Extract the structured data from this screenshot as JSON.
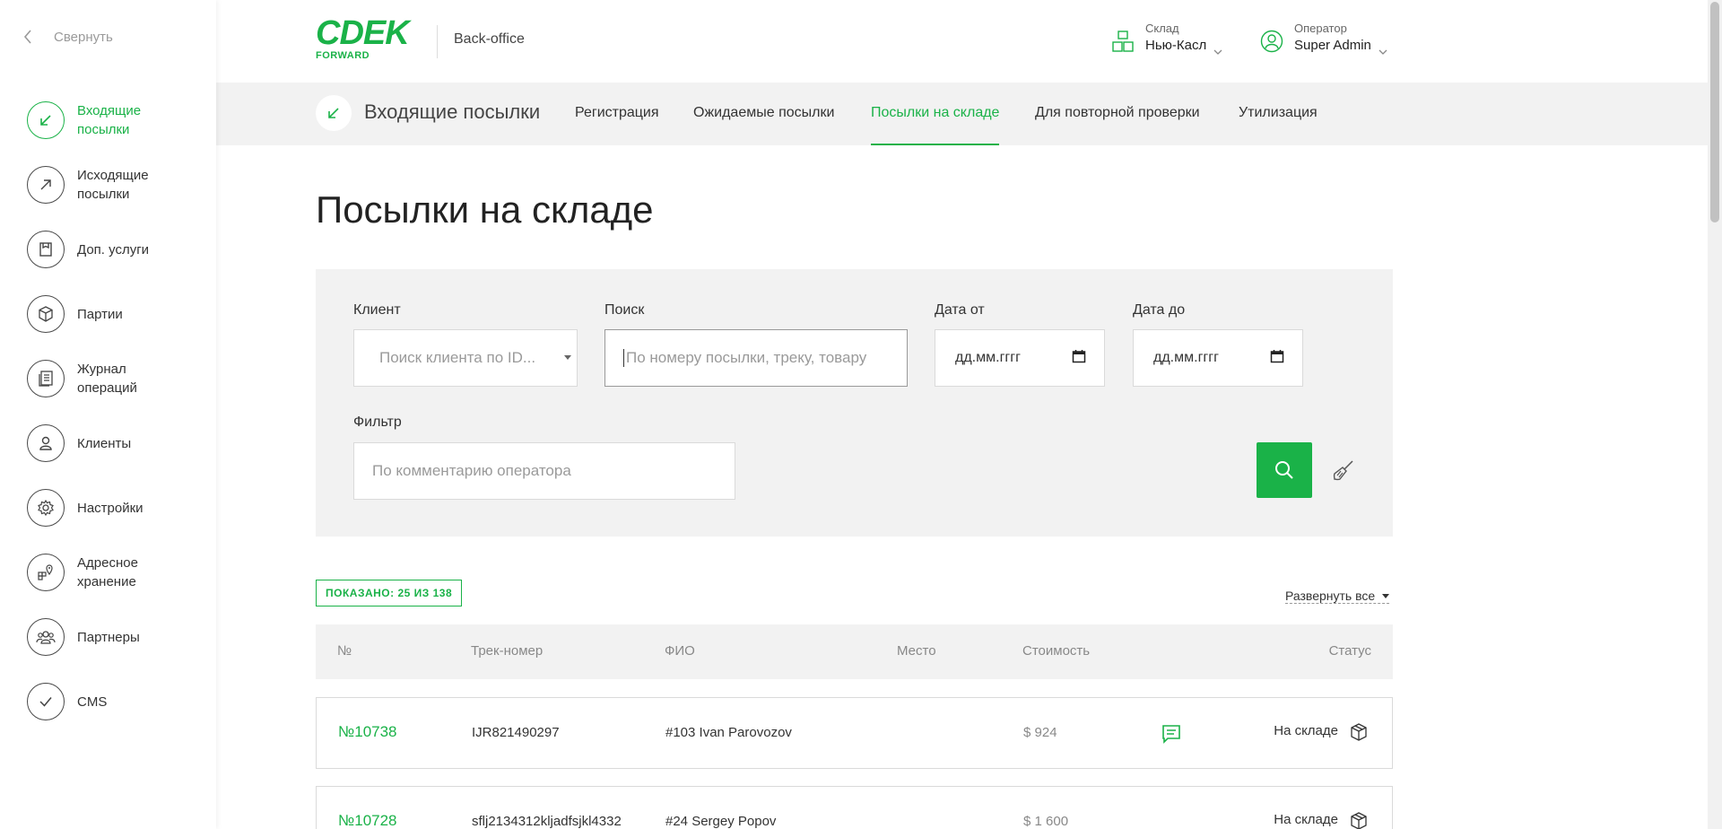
{
  "sidebar": {
    "collapse_label": "Свернуть",
    "items": [
      {
        "label_line1": "Входящие",
        "label_line2": "посылки",
        "icon": "arrow-in-icon",
        "active": true
      },
      {
        "label_line1": "Исходящие",
        "label_line2": "посылки",
        "icon": "arrow-out-icon",
        "active": false
      },
      {
        "label_line1": "Доп. услуги",
        "label_line2": "",
        "icon": "document-icon",
        "active": false
      },
      {
        "label_line1": "Партии",
        "label_line2": "",
        "icon": "box-icon",
        "active": false
      },
      {
        "label_line1": "Журнал",
        "label_line2": "операций",
        "icon": "journal-icon",
        "active": false
      },
      {
        "label_line1": "Клиенты",
        "label_line2": "",
        "icon": "user-icon",
        "active": false
      },
      {
        "label_line1": "Настройки",
        "label_line2": "",
        "icon": "gear-icon",
        "active": false
      },
      {
        "label_line1": "Адресное",
        "label_line2": "хранение",
        "icon": "storage-location-icon",
        "active": false
      },
      {
        "label_line1": "Партнеры",
        "label_line2": "",
        "icon": "partners-icon",
        "active": false
      },
      {
        "label_line1": "CMS",
        "label_line2": "",
        "icon": "check-icon",
        "active": false
      }
    ]
  },
  "header": {
    "logo_text": "CDEK",
    "logo_sub": "FORWARD",
    "app_name": "Back-office",
    "warehouse_caption": "Склад",
    "warehouse_value": "Нью-Касл",
    "operator_caption": "Оператор",
    "operator_value": "Super Admin"
  },
  "tabsbar": {
    "section_title": "Входящие посылки",
    "tabs": [
      {
        "label": "Регистрация",
        "active": false
      },
      {
        "label": "Ожидаемые посылки",
        "active": false
      },
      {
        "label": "Посылки на складе",
        "active": true
      },
      {
        "label": "Для повторной проверки",
        "active": false
      },
      {
        "label": "Утилизация",
        "active": false
      }
    ]
  },
  "page": {
    "title": "Посылки на складе"
  },
  "filters": {
    "client_label": "Клиент",
    "client_placeholder": "Поиск клиента по ID...",
    "search_label": "Поиск",
    "search_placeholder": "По номеру посылки, треку, товару",
    "date_from_label": "Дата от",
    "date_from_value": "дд.мм.гггг",
    "date_to_label": "Дата до",
    "date_to_value": "дд.мм.гггг",
    "filter_label": "Фильтр",
    "filter_placeholder": "По комментарию оператора"
  },
  "results": {
    "shown_text": "ПОКАЗАНО: 25 ИЗ 138",
    "expand_all": "Развернуть все"
  },
  "table": {
    "headers": {
      "num": "№",
      "track": "Трек-номер",
      "name": "ФИО",
      "place": "Место",
      "cost": "Стоимость",
      "status": "Статус"
    },
    "rows": [
      {
        "num": "№10738",
        "track": "IJR821490297",
        "name": "#103 Ivan Parovozov",
        "place": "",
        "cost": "$ 924",
        "has_comment": true,
        "status": "На складе"
      },
      {
        "num": "№10728",
        "track": "sflj2134312kljadfsjkl4332",
        "name": "#24 Sergey Popov",
        "place": "",
        "cost": "$ 1 600",
        "has_comment": false,
        "status": "На складе"
      }
    ]
  },
  "colors": {
    "accent": "#1ab248",
    "panel_bg": "#f2f2f2"
  }
}
